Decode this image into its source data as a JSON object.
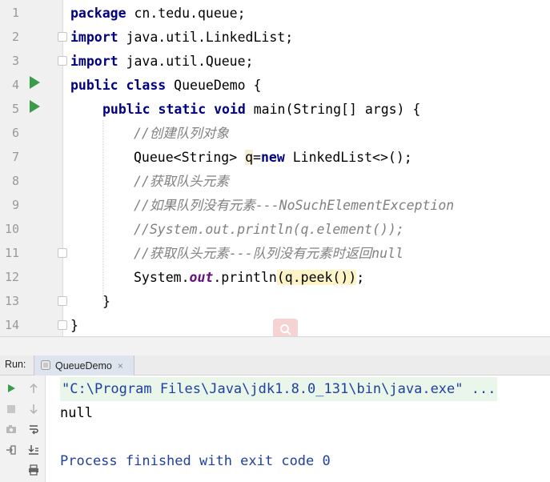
{
  "editor": {
    "line_numbers": [
      "1",
      "2",
      "3",
      "4",
      "5",
      "6",
      "7",
      "8",
      "9",
      "10",
      "11",
      "12",
      "13",
      "14"
    ],
    "lines": {
      "l1": {
        "kw": "package",
        "rest": " cn.tedu.queue;"
      },
      "l2": {
        "kw": "import",
        "rest": " java.util.LinkedList;"
      },
      "l3": {
        "kw": "import",
        "rest": " java.util.Queue;"
      },
      "l4": {
        "kw": "public class",
        "rest": " QueueDemo {"
      },
      "l5": {
        "kw": "public static void",
        "rest": " main(String[] args) {"
      },
      "l6": {
        "comment": "//创建队列对象"
      },
      "l7": {
        "a": "Queue<String> ",
        "var": "q",
        "b": "=",
        "kw": "new",
        "c": " LinkedList<>();"
      },
      "l8": {
        "comment": "//获取队头元素"
      },
      "l9": {
        "comment": "//如果队列没有元素---NoSuchElementException"
      },
      "l10": {
        "comment": "//System.out.println(q.element());"
      },
      "l11": {
        "comment": "//获取队头元素---队列没有元素时返回null"
      },
      "l12": {
        "a": "System.",
        "field": "out",
        "b": ".println",
        "p1": "(",
        "call": "q.peek()",
        "p2": ")",
        "c": ";"
      },
      "l13": {
        "text": "}"
      },
      "l14": {
        "text": "}"
      }
    }
  },
  "run_panel": {
    "label": "Run:",
    "tab_label": "QueueDemo",
    "tab_close": "×",
    "console_lines": [
      "\"C:\\Program Files\\Java\\jdk1.8.0_131\\bin\\java.exe\" ...",
      "null",
      "",
      "Process finished with exit code 0"
    ],
    "colors": {
      "command": "#1f3fa3",
      "command_bg": "#e9f6e9",
      "output": "#000000",
      "exit": "#1f3fa3"
    }
  },
  "icons": [
    "run-gutter-icon",
    "fold-icon",
    "search-icon",
    "rerun-icon",
    "stop-icon",
    "up-arrow-icon",
    "down-arrow-icon",
    "camera-icon",
    "wrap-icon",
    "login-icon",
    "scroll-end-icon",
    "print-icon",
    "java-class-icon"
  ]
}
